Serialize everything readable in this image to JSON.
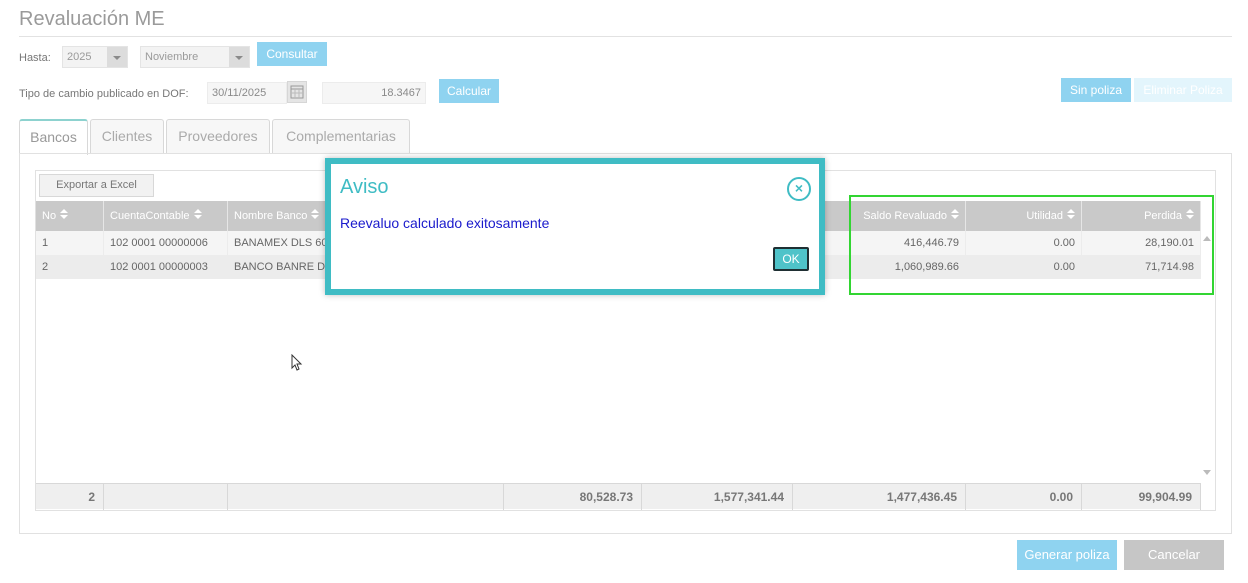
{
  "page": {
    "title": "Revaluación ME"
  },
  "filters": {
    "hasta_label": "Hasta:",
    "year": "2025",
    "month": "Noviembre",
    "consultar_label": "Consultar",
    "tipo_cambio_label": "Tipo de cambio publicado en DOF:",
    "date": "30/11/2025",
    "rate": "18.3467",
    "calcular_label": "Calcular"
  },
  "actions": {
    "sin_poliza": "Sin poliza",
    "eliminar_poliza": "Eliminar Poliza",
    "generar_poliza": "Generar poliza",
    "cancelar": "Cancelar"
  },
  "tabs": [
    {
      "label": "Bancos",
      "active": true
    },
    {
      "label": "Clientes",
      "active": false
    },
    {
      "label": "Proveedores",
      "active": false
    },
    {
      "label": "Complementarias",
      "active": false
    }
  ],
  "grid": {
    "export_label": "Exportar a Excel",
    "columns": [
      "No",
      "CuentaContable",
      "Nombre Banco",
      "Saldo Revaluado",
      "Utilidad",
      "Perdida"
    ],
    "rows": [
      {
        "no": "1",
        "cuenta": "102 0001 00000006",
        "banco": "BANAMEX DLS 60",
        "saldo_revaluado": "416,446.79",
        "utilidad": "0.00",
        "perdida": "28,190.01"
      },
      {
        "no": "2",
        "cuenta": "102 0001 00000003",
        "banco": "BANCO BANRE DE",
        "saldo_revaluado": "1,060,989.66",
        "utilidad": "0.00",
        "perdida": "71,714.98"
      }
    ],
    "totals": {
      "count": "2",
      "col4": "80,528.73",
      "col5": "1,577,341.44",
      "saldo_revaluado": "1,477,436.45",
      "utilidad": "0.00",
      "perdida": "99,904.99"
    }
  },
  "modal": {
    "title": "Aviso",
    "message": "Reevaluo calculado exitosamente",
    "ok_label": "OK",
    "close_glyph": "×"
  },
  "colors": {
    "accent": "#3fbcc4",
    "button": "#8fd3f0",
    "highlight": "#32d532"
  }
}
